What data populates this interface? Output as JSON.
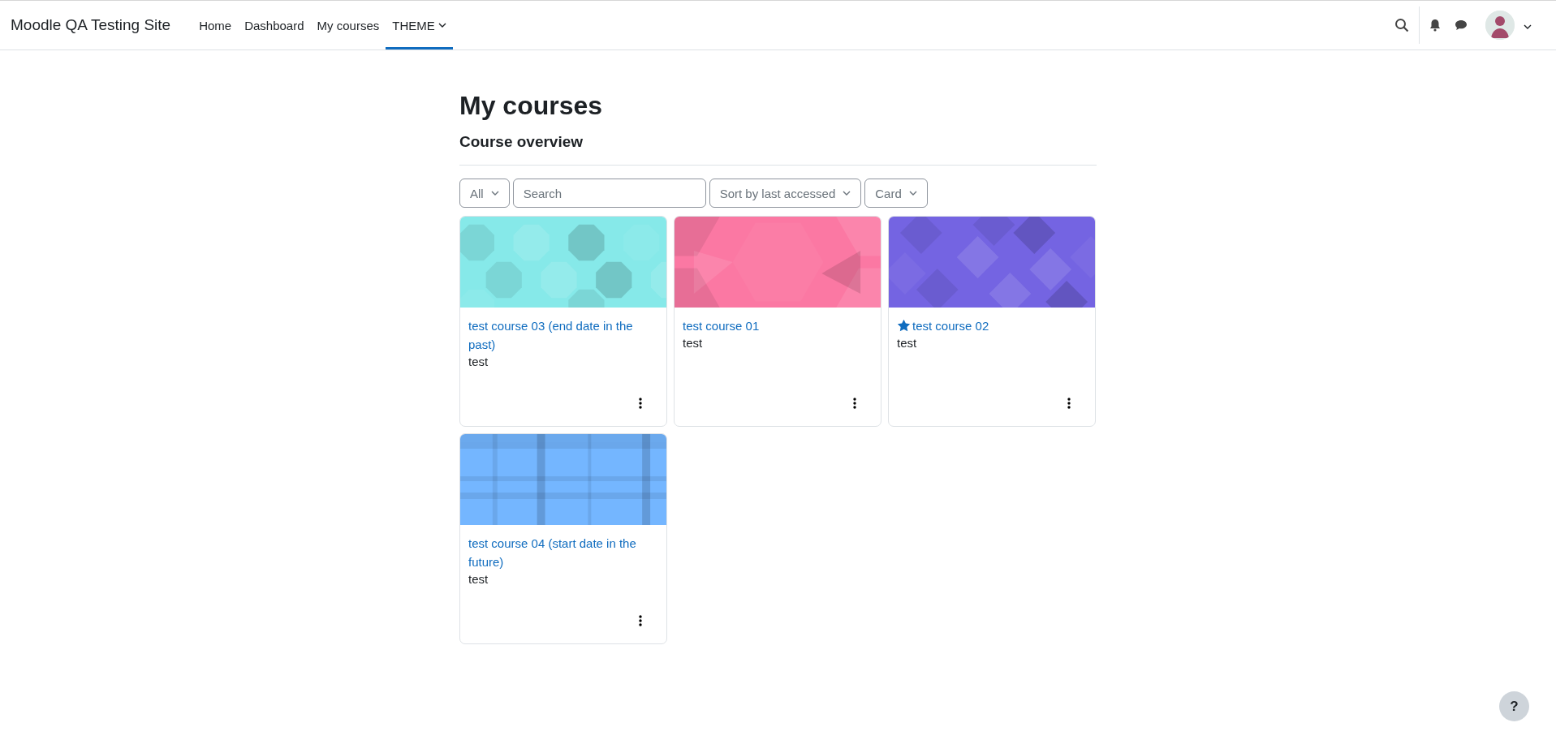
{
  "header": {
    "site_name": "Moodle QA Testing Site",
    "nav": [
      {
        "label": "Home",
        "selected": false,
        "dropdown": false
      },
      {
        "label": "Dashboard",
        "selected": false,
        "dropdown": false
      },
      {
        "label": "My courses",
        "selected": false,
        "dropdown": false
      },
      {
        "label": "THEME",
        "selected": true,
        "dropdown": true
      }
    ]
  },
  "page": {
    "title": "My courses",
    "section": "Course overview",
    "filters": {
      "grouping": "All",
      "search_placeholder": "Search",
      "sort": "Sort by last accessed",
      "view": "Card"
    },
    "courses": [
      {
        "title": "test course 03 (end date in the past)",
        "category": "test",
        "starred": false,
        "kind": "octagons",
        "color": "#86e9e9"
      },
      {
        "title": "test course 01",
        "category": "test",
        "starred": false,
        "kind": "hexagons",
        "color": "#fb78a3"
      },
      {
        "title": "test course 02",
        "category": "test",
        "starred": true,
        "kind": "diamonds",
        "color": "#7464e2"
      },
      {
        "title": "test course 04 (start date in the future)",
        "category": "test",
        "starred": false,
        "kind": "plaid",
        "color": "#74b6ff"
      }
    ]
  },
  "help": {
    "label": "?"
  }
}
